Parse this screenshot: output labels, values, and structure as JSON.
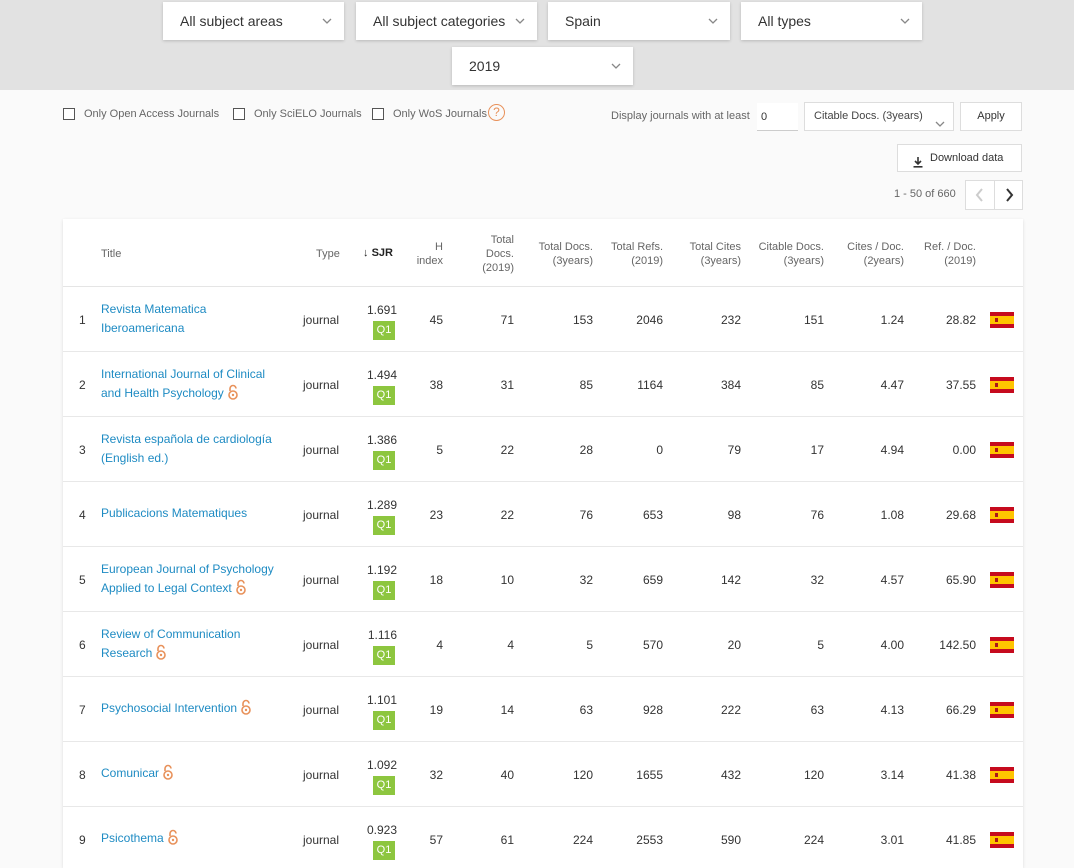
{
  "filters": {
    "subject_areas": "All subject areas",
    "subject_categories": "All subject categories",
    "country": "Spain",
    "types": "All types",
    "year": "2019"
  },
  "options": {
    "open_access": "Only Open Access Journals",
    "scielo": "Only SciELO Journals",
    "wos": "Only WoS Journals",
    "help": "?",
    "display_label": "Display journals with at least",
    "min_value": "0",
    "citable_select": "Citable Docs. (3years)",
    "apply": "Apply",
    "download": "Download data"
  },
  "pagination": {
    "text": "1 - 50 of 660"
  },
  "columns": {
    "title": "Title",
    "type": "Type",
    "sjr": "SJR",
    "h1": "H",
    "h2": "index",
    "td1": "Total",
    "td2": "Docs.",
    "td3": "(2019)",
    "td3y1": "Total Docs.",
    "td3y2": "(3years)",
    "tr1": "Total Refs.",
    "tr2": "(2019)",
    "tc1": "Total Cites",
    "tc2": "(3years)",
    "cd1": "Citable Docs.",
    "cd2": "(3years)",
    "cpd1": "Cites / Doc.",
    "cpd2": "(2years)",
    "rpd1": "Ref. / Doc.",
    "rpd2": "(2019)"
  },
  "colors": {
    "link": "#1e8bc3",
    "q1": "#8dc63f",
    "open_access": "#e8915a"
  },
  "rows": [
    {
      "idx": "1",
      "title1": "Revista Matematica",
      "title2": "Iberoamericana",
      "oa": false,
      "type": "journal",
      "sjr": "1.691",
      "q": "Q1",
      "h": "45",
      "td": "71",
      "td3": "153",
      "tr": "2046",
      "tc": "232",
      "cd": "151",
      "cpd": "1.24",
      "rpd": "28.82"
    },
    {
      "idx": "2",
      "title1": "International Journal of Clinical",
      "title2": "and Health Psychology",
      "oa": true,
      "type": "journal",
      "sjr": "1.494",
      "q": "Q1",
      "h": "38",
      "td": "31",
      "td3": "85",
      "tr": "1164",
      "tc": "384",
      "cd": "85",
      "cpd": "4.47",
      "rpd": "37.55"
    },
    {
      "idx": "3",
      "title1": "Revista española de cardiología",
      "title2": "(English ed.)",
      "oa": false,
      "type": "journal",
      "sjr": "1.386",
      "q": "Q1",
      "h": "5",
      "td": "22",
      "td3": "28",
      "tr": "0",
      "tc": "79",
      "cd": "17",
      "cpd": "4.94",
      "rpd": "0.00"
    },
    {
      "idx": "4",
      "title1": "Publicacions Matematiques",
      "title2": "",
      "oa": false,
      "type": "journal",
      "sjr": "1.289",
      "q": "Q1",
      "h": "23",
      "td": "22",
      "td3": "76",
      "tr": "653",
      "tc": "98",
      "cd": "76",
      "cpd": "1.08",
      "rpd": "29.68"
    },
    {
      "idx": "5",
      "title1": "European Journal of Psychology",
      "title2": "Applied to Legal Context",
      "oa": true,
      "type": "journal",
      "sjr": "1.192",
      "q": "Q1",
      "h": "18",
      "td": "10",
      "td3": "32",
      "tr": "659",
      "tc": "142",
      "cd": "32",
      "cpd": "4.57",
      "rpd": "65.90"
    },
    {
      "idx": "6",
      "title1": "Review of Communication",
      "title2": "Research",
      "oa": true,
      "type": "journal",
      "sjr": "1.116",
      "q": "Q1",
      "h": "4",
      "td": "4",
      "td3": "5",
      "tr": "570",
      "tc": "20",
      "cd": "5",
      "cpd": "4.00",
      "rpd": "142.50"
    },
    {
      "idx": "7",
      "title1": "Psychosocial Intervention",
      "title2": "",
      "oa": true,
      "type": "journal",
      "sjr": "1.101",
      "q": "Q1",
      "h": "19",
      "td": "14",
      "td3": "63",
      "tr": "928",
      "tc": "222",
      "cd": "63",
      "cpd": "4.13",
      "rpd": "66.29"
    },
    {
      "idx": "8",
      "title1": "Comunicar",
      "title2": "",
      "oa": true,
      "type": "journal",
      "sjr": "1.092",
      "q": "Q1",
      "h": "32",
      "td": "40",
      "td3": "120",
      "tr": "1655",
      "tc": "432",
      "cd": "120",
      "cpd": "3.14",
      "rpd": "41.38"
    },
    {
      "idx": "9",
      "title1": "Psicothema",
      "title2": "",
      "oa": true,
      "type": "journal",
      "sjr": "0.923",
      "q": "Q1",
      "h": "57",
      "td": "61",
      "td3": "224",
      "tr": "2553",
      "tc": "590",
      "cd": "224",
      "cpd": "3.01",
      "rpd": "41.85"
    }
  ]
}
